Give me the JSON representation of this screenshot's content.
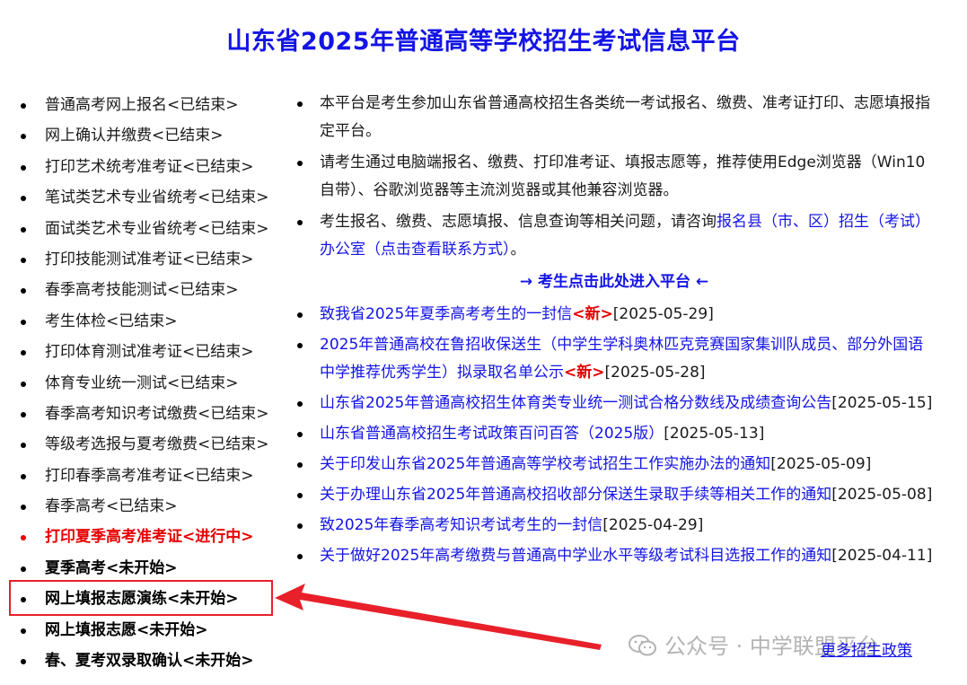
{
  "header": {
    "title": "山东省2025年普通高等学校招生考试信息平台"
  },
  "sidebar": {
    "items": [
      {
        "label": "普通高考网上报名<已结束>",
        "state": "ended"
      },
      {
        "label": "网上确认并缴费<已结束>",
        "state": "ended"
      },
      {
        "label": "打印艺术统考准考证<已结束>",
        "state": "ended"
      },
      {
        "label": "笔试类艺术专业省统考<已结束>",
        "state": "ended"
      },
      {
        "label": "面试类艺术专业省统考<已结束>",
        "state": "ended"
      },
      {
        "label": "打印技能测试准考证<已结束>",
        "state": "ended"
      },
      {
        "label": "春季高考技能测试<已结束>",
        "state": "ended"
      },
      {
        "label": "考生体检<已结束>",
        "state": "ended"
      },
      {
        "label": "打印体育测试准考证<已结束>",
        "state": "ended"
      },
      {
        "label": "体育专业统一测试<已结束>",
        "state": "ended"
      },
      {
        "label": "春季高考知识考试缴费<已结束>",
        "state": "ended"
      },
      {
        "label": "等级考选报与夏考缴费<已结束>",
        "state": "ended"
      },
      {
        "label": "打印春季高考准考证<已结束>",
        "state": "ended"
      },
      {
        "label": "春季高考<已结束>",
        "state": "ended"
      },
      {
        "label": "打印夏季高考准考证<进行中>",
        "state": "active"
      },
      {
        "label": "夏季高考<未开始>",
        "state": "pending"
      },
      {
        "label": "网上填报志愿演练<未开始>",
        "state": "pending"
      },
      {
        "label": "网上填报志愿<未开始>",
        "state": "pending"
      },
      {
        "label": "春、夏考双录取确认<未开始>",
        "state": "pending"
      }
    ]
  },
  "notices": {
    "n1": "本平台是考生参加山东省普通高校招生各类统一考试报名、缴费、准考证打印、志愿填报指定平台。",
    "n2": "请考生通过电脑端报名、缴费、打印准考证、填报志愿等，推荐使用Edge浏览器（Win10自带）、谷歌浏览器等主流浏览器或其他兼容浏览器。",
    "n3_text": "考生报名、缴费、志愿填报、信息查询等相关问题，请咨询",
    "n3_link": "报名县（市、区）招生（考试）办公室（点击查看联系方式）",
    "n3_end": "。"
  },
  "enter_platform": "→ 考生点击此处进入平台 ←",
  "news": [
    {
      "title": "致我省2025年夏季高考考生的一封信",
      "new": "<新>",
      "date": "[2025-05-29]"
    },
    {
      "title": "2025年普通高校在鲁招收保送生（中学生学科奥林匹克竞赛国家集训队成员、部分外国语中学推荐优秀学生）拟录取名单公示",
      "new": "<新>",
      "date": "[2025-05-28]"
    },
    {
      "title": "山东省2025年普通高校招生体育类专业统一测试合格分数线及成绩查询公告",
      "new": "",
      "date": "[2025-05-15]"
    },
    {
      "title": "山东省普通高校招生考试政策百问百答（2025版）",
      "new": "",
      "date": "[2025-05-13]"
    },
    {
      "title": "关于印发山东省2025年普通高等学校考试招生工作实施办法的通知",
      "new": "",
      "date": "[2025-05-09]"
    },
    {
      "title": "关于办理山东省2025年普通高校招收部分保送生录取手续等相关工作的通知",
      "new": "",
      "date": "[2025-05-08]"
    },
    {
      "title": "致2025年春季高考知识考试考生的一封信",
      "new": "",
      "date": "[2025-04-29]"
    },
    {
      "title": "关于做好2025年高考缴费与普通高中学业水平等级考试科目选报工作的通知",
      "new": "",
      "date": "[2025-04-11]"
    }
  ],
  "more_link": "更多招生政策",
  "watermark": {
    "text": "公众号 · 中学联盟平台",
    "icon": "wechat-icon"
  },
  "colors": {
    "title": "#1414e6",
    "link": "#1414e6",
    "active": "#e60000",
    "highlight": "#e8202a"
  }
}
